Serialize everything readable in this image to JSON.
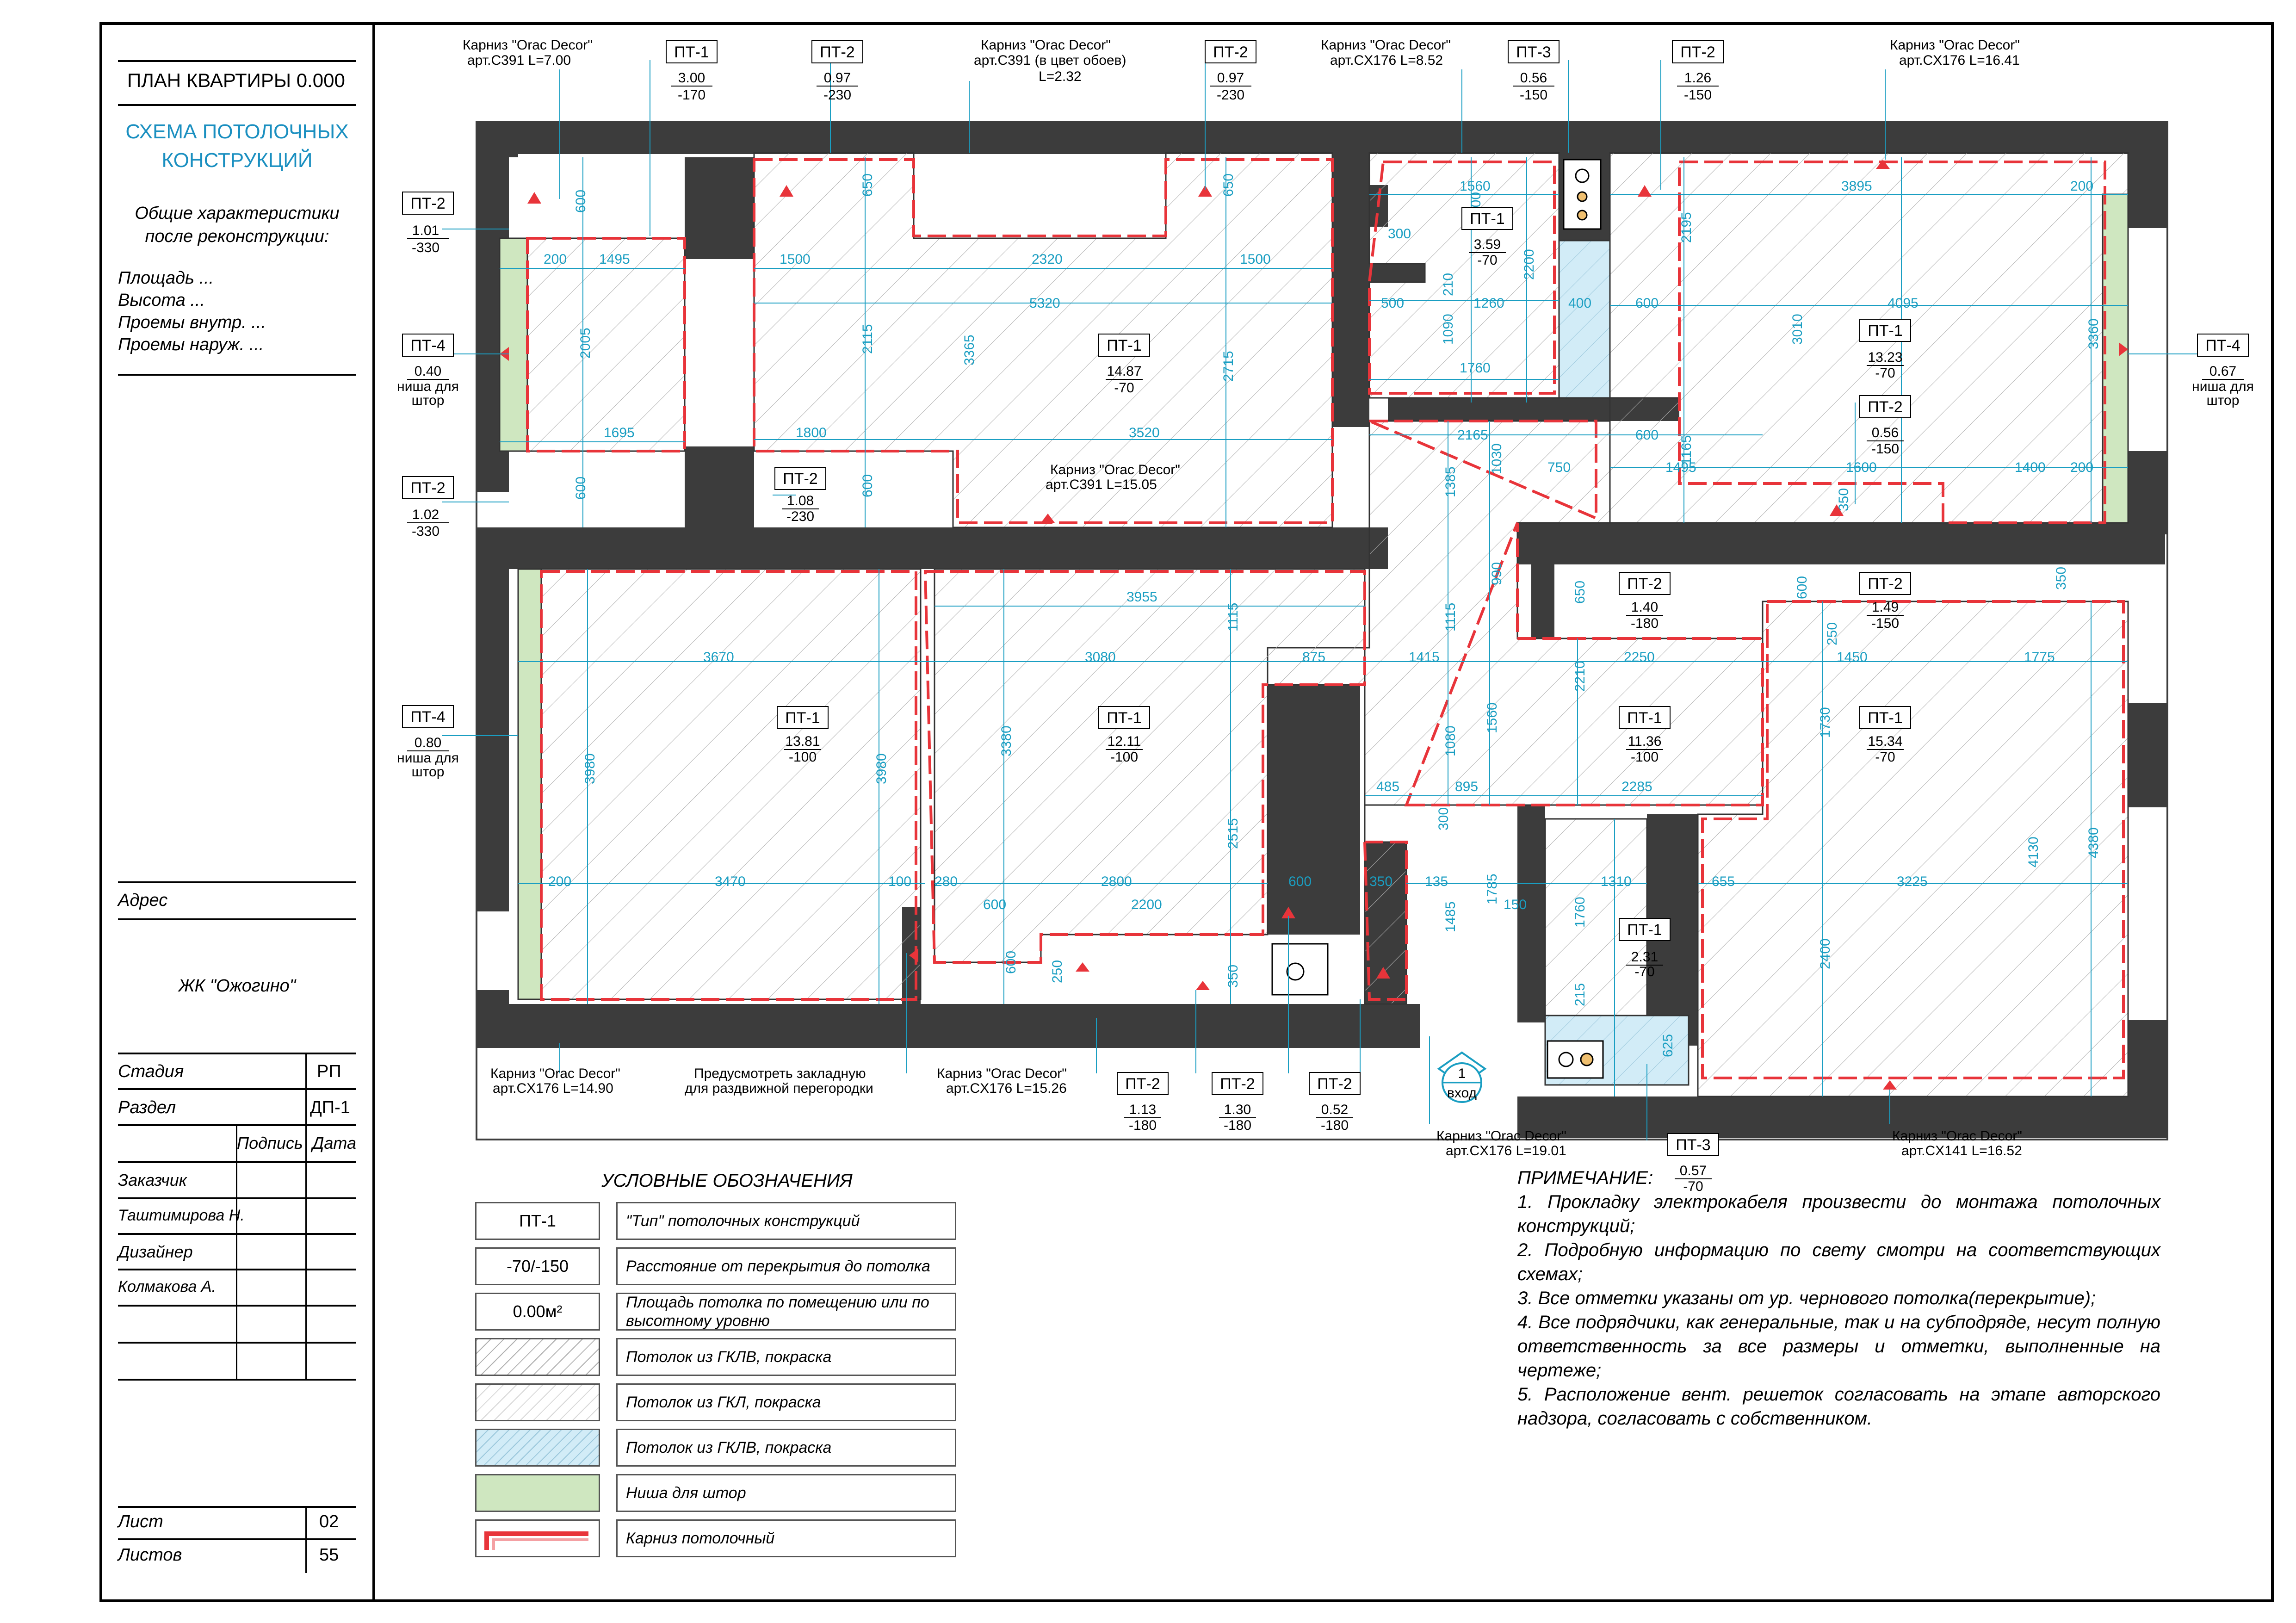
{
  "stamp": {
    "title": "ПЛАН КВАРТИРЫ 0.000",
    "subtitle_line1": "СХЕМА ПОТОЛОЧНЫХ",
    "subtitle_line2": "КОНСТРУКЦИЙ",
    "general_line1": "Общие характеристики",
    "general_line2": "после реконструкции:",
    "area": "Площадь ...",
    "height": "Высота ...",
    "openings_in": "Проемы внутр. ...",
    "openings_out": "Проемы наруж. ...",
    "address_label": "Адрес",
    "address_value": "ЖК \"Ожогино\"",
    "stage_label": "Стадия",
    "stage_value": "РП",
    "section_label": "Раздел",
    "section_value": "ДП-1",
    "sign_label": "Подпись",
    "date_label": "Дата",
    "customer_label": "Заказчик",
    "customer_name": "Таштимирова Н.",
    "designer_label": "Дизайнер",
    "designer_name": "Колмакова А.",
    "sheet_label": "Лист",
    "sheet_value": "02",
    "sheets_label": "Листов",
    "sheets_value": "55"
  },
  "legend": {
    "title": "УСЛОВНЫЕ ОБОЗНАЧЕНИЯ",
    "rows": [
      {
        "symbol": "ПТ-1",
        "text": "\"Тип\" потолочных конструкций"
      },
      {
        "symbol": "-70/-150",
        "text": "Расстояние от перекрытия до потолка"
      },
      {
        "symbol": "0.00м²",
        "text": "Площадь потолка по помещению или по высотному уровню"
      },
      {
        "symbol": "",
        "text": "Потолок из ГКЛВ, покраска"
      },
      {
        "symbol": "",
        "text": "Потолок из ГКЛ, покраска"
      },
      {
        "symbol": "",
        "text": "Потолок из ГКЛВ, покраска"
      },
      {
        "symbol": "",
        "text": "Ниша для штор"
      },
      {
        "symbol": "",
        "text": "Карниз потолочный"
      }
    ]
  },
  "notes": {
    "title": "ПРИМЕЧАНИЕ:",
    "items": [
      "1. Прокладку электрокабеля произвести до монтажа потолочных конструкций;",
      "2. Подробную информацию по свету смотри на соответствующих схемах;",
      "3. Все отметки указаны от ур. чернового потолка(перекрытие);",
      "4. Все подрядчики, как генеральные, так и на субподряде, несут полную ответственность за все размеры и отметки, выполненные на чертеже;",
      "5. Расположение вент. решеток согласовать на этапе авторского надзора, согласовать с собственником."
    ]
  },
  "plan": {
    "entrance": {
      "num": "1",
      "label": "вход"
    },
    "cornices": [
      {
        "l1": "Карниз \"Orac Decor\"",
        "l2": "арт.C391 L=7.00"
      },
      {
        "l1": "Карниз \"Orac Decor\"",
        "l2": "арт.C391 (в цвет обоев)",
        "l3": "L=2.32"
      },
      {
        "l1": "Карниз \"Orac Decor\"",
        "l2": "арт.CX176 L=8.52"
      },
      {
        "l1": "Карниз \"Orac Decor\"",
        "l2": "арт.CX176 L=16.41"
      },
      {
        "l1": "Карниз \"Orac Decor\"",
        "l2": "арт.C391 L=15.05"
      },
      {
        "l1": "Карниз \"Orac Decor\"",
        "l2": "арт.CX176 L=14.90"
      },
      {
        "l1": "Предусмотреть закладную",
        "l2": "для раздвижной перегородки"
      },
      {
        "l1": "Карниз \"Orac Decor\"",
        "l2": "арт.CX176 L=15.26"
      },
      {
        "l1": "Карниз \"Orac Decor\"",
        "l2": "арт.CX176 L=19.01"
      },
      {
        "l1": "Карниз \"Orac Decor\"",
        "l2": "арт.CX141 L=16.52"
      }
    ],
    "tags": [
      {
        "type": "ПТ-1",
        "area": "3.00",
        "level": "-170"
      },
      {
        "type": "ПТ-2",
        "area": "0.97",
        "level": "-230"
      },
      {
        "type": "ПТ-2",
        "area": "0.97",
        "level": "-230"
      },
      {
        "type": "ПТ-3",
        "area": "0.56",
        "level": "-150"
      },
      {
        "type": "ПТ-2",
        "area": "1.26",
        "level": "-150"
      },
      {
        "type": "ПТ-2",
        "area": "1.01",
        "level": "-330"
      },
      {
        "type": "ПТ-4",
        "area": "0.40",
        "level": "ниша для",
        "level2": "штор"
      },
      {
        "type": "ПТ-2",
        "area": "1.02",
        "level": "-330"
      },
      {
        "type": "ПТ-4",
        "area": "0.80",
        "level": "ниша для",
        "level2": "штор"
      },
      {
        "type": "ПТ-4",
        "area": "0.67",
        "level": "ниша для",
        "level2": "штор"
      },
      {
        "type": "ПТ-1",
        "area": "14.87",
        "level": "-70"
      },
      {
        "type": "ПТ-1",
        "area": "3.59",
        "level": "-70"
      },
      {
        "type": "ПТ-1",
        "area": "13.23",
        "level": "-70"
      },
      {
        "type": "ПТ-2",
        "area": "0.56",
        "level": "-150"
      },
      {
        "type": "ПТ-2",
        "area": "1.08",
        "level": "-230"
      },
      {
        "type": "ПТ-2",
        "area": "1.40",
        "level": "-180"
      },
      {
        "type": "ПТ-2",
        "area": "1.49",
        "level": "-150"
      },
      {
        "type": "ПТ-1",
        "area": "13.81",
        "level": "-100"
      },
      {
        "type": "ПТ-1",
        "area": "12.11",
        "level": "-100"
      },
      {
        "type": "ПТ-1",
        "area": "11.36",
        "level": "-100"
      },
      {
        "type": "ПТ-1",
        "area": "15.34",
        "level": "-70"
      },
      {
        "type": "ПТ-1",
        "area": "2.31",
        "level": "-70"
      },
      {
        "type": "ПТ-2",
        "area": "1.13",
        "level": "-180"
      },
      {
        "type": "ПТ-2",
        "area": "1.30",
        "level": "-180"
      },
      {
        "type": "ПТ-2",
        "area": "0.52",
        "level": "-180"
      },
      {
        "type": "ПТ-3",
        "area": "0.57",
        "level": "-70"
      }
    ],
    "dims": [
      "600",
      "200",
      "1495",
      "2005",
      "1695",
      "600",
      "650",
      "1500",
      "2320",
      "1500",
      "5320",
      "2115",
      "3365",
      "2715",
      "1800",
      "3520",
      "600",
      "650",
      "1560",
      "900",
      "300",
      "3.59",
      "500",
      "210",
      "1260",
      "2200",
      "1090",
      "1760",
      "400",
      "600",
      "2195",
      "3895",
      "200",
      "4095",
      "3010",
      "3360",
      "2165",
      "1385",
      "1030",
      "750",
      "600",
      "1495",
      "1165",
      "1600",
      "1400",
      "200",
      "350",
      "3955",
      "1115",
      "990",
      "650",
      "600",
      "350",
      "3670",
      "3080",
      "875",
      "1415",
      "2250",
      "1450",
      "1775",
      "250",
      "1730",
      "2210",
      "3980",
      "3980",
      "3380",
      "1560",
      "485",
      "895",
      "1080",
      "2285",
      "2515",
      "200",
      "3470",
      "100",
      "280",
      "2800",
      "600",
      "350",
      "135",
      "300",
      "1785",
      "1310",
      "655",
      "3225",
      "4130",
      "4380",
      "600",
      "2200",
      "150",
      "1485",
      "1760",
      "600",
      "250",
      "350",
      "215",
      "625",
      "2400"
    ],
    "colors": {
      "wall": "#3c3c3c",
      "cornice": "#e8343a",
      "dim": "#1a9ec2",
      "niche": "#cfe7c0",
      "moist": "#d2ecf7"
    }
  }
}
